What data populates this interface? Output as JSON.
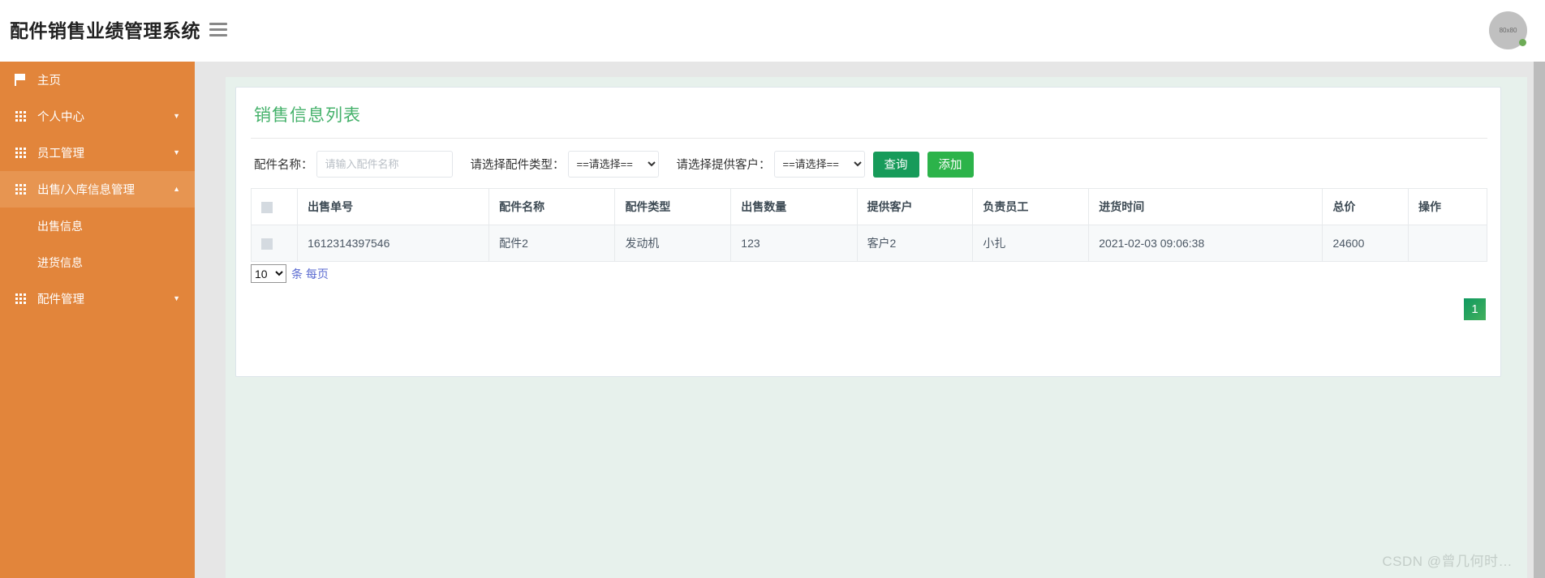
{
  "header": {
    "title": "配件销售业绩管理系统",
    "menu_icon": "hamburger-icon",
    "avatar_label": "80x80"
  },
  "sidebar": {
    "items": [
      {
        "label": "主页",
        "icon": "flag-icon",
        "has_caret": false,
        "active": false
      },
      {
        "label": "个人中心",
        "icon": "grid-icon",
        "has_caret": true,
        "caret": "▼",
        "active": false
      },
      {
        "label": "员工管理",
        "icon": "grid-icon",
        "has_caret": true,
        "caret": "▼",
        "active": false
      },
      {
        "label": "出售/入库信息管理",
        "icon": "grid-icon",
        "has_caret": true,
        "caret": "▲",
        "active": true
      },
      {
        "label": "配件管理",
        "icon": "grid-icon",
        "has_caret": true,
        "caret": "▼",
        "active": false
      }
    ],
    "subitems": [
      {
        "label": "出售信息"
      },
      {
        "label": "进货信息"
      }
    ]
  },
  "card": {
    "title": "销售信息列表"
  },
  "search": {
    "name_label": "配件名称：",
    "name_placeholder": "请输入配件名称",
    "name_value": "",
    "type_label": "请选择配件类型：",
    "type_value": "==请选择==",
    "customer_label": "请选择提供客户：",
    "customer_value": "==请选择==",
    "query_button": "查询",
    "add_button": "添加"
  },
  "table": {
    "columns": [
      "出售单号",
      "配件名称",
      "配件类型",
      "出售数量",
      "提供客户",
      "负责员工",
      "进货时间",
      "总价",
      "操作"
    ],
    "rows": [
      {
        "order_no": "1612314397546",
        "part_name": "配件2",
        "part_type": "发动机",
        "quantity": "123",
        "customer": "客户2",
        "employee": "小扎",
        "time": "2021-02-03 09:06:38",
        "total_price": "24600",
        "operation": ""
      }
    ]
  },
  "pagination": {
    "page_size": "10",
    "per_page_text": "条 每页",
    "current_page": "1"
  },
  "watermark": "CSDN @曾几何时…",
  "colors": {
    "sidebar": "#e2853b",
    "sidebar_active": "#e79551",
    "title_green": "#44b16a",
    "query_green": "#179b5a",
    "add_green": "#2cb34a",
    "panel_green": "#e7f1ec"
  }
}
